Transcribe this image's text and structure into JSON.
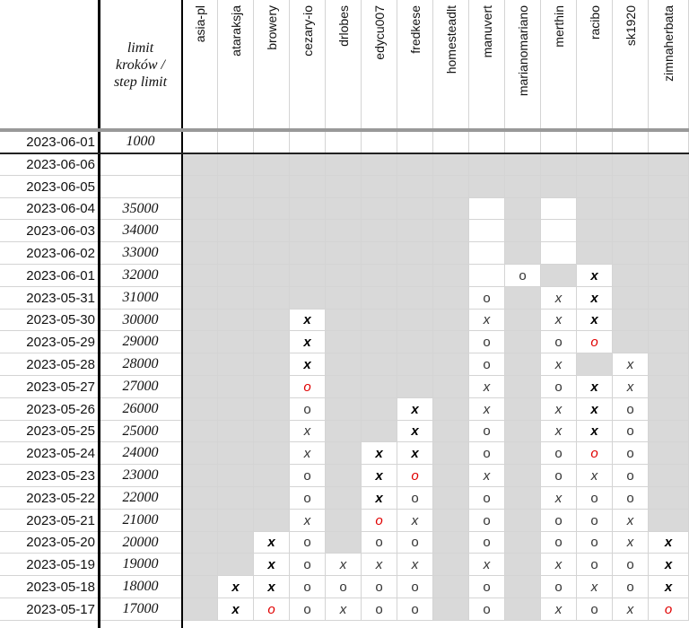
{
  "header": {
    "limit_label_line1": "limit",
    "limit_label_line2": "kroków /",
    "limit_label_line3": "step limit",
    "users": [
      "asia-pl",
      "ataraksja",
      "browery",
      "cezary-io",
      "drlobes",
      "edycu007",
      "fredkese",
      "homesteadlt",
      "manuvert",
      "marianomariano",
      "merthin",
      "racibo",
      "sk1920",
      "zimnaherbata"
    ]
  },
  "summary_row": {
    "date": "2023-06-01",
    "limit": "1000"
  },
  "rows": [
    {
      "date": "2023-06-06",
      "limit": ""
    },
    {
      "date": "2023-06-05",
      "limit": ""
    },
    {
      "date": "2023-06-04",
      "limit": "35000"
    },
    {
      "date": "2023-06-03",
      "limit": "34000"
    },
    {
      "date": "2023-06-02",
      "limit": "33000"
    },
    {
      "date": "2023-06-01",
      "limit": "32000"
    },
    {
      "date": "2023-05-31",
      "limit": "31000"
    },
    {
      "date": "2023-05-30",
      "limit": "30000"
    },
    {
      "date": "2023-05-29",
      "limit": "29000"
    },
    {
      "date": "2023-05-28",
      "limit": "28000"
    },
    {
      "date": "2023-05-27",
      "limit": "27000"
    },
    {
      "date": "2023-05-26",
      "limit": "26000"
    },
    {
      "date": "2023-05-25",
      "limit": "25000"
    },
    {
      "date": "2023-05-24",
      "limit": "24000"
    },
    {
      "date": "2023-05-23",
      "limit": "23000"
    },
    {
      "date": "2023-05-22",
      "limit": "22000"
    },
    {
      "date": "2023-05-21",
      "limit": "21000"
    },
    {
      "date": "2023-05-20",
      "limit": "20000"
    },
    {
      "date": "2023-05-19",
      "limit": "19000"
    },
    {
      "date": "2023-05-18",
      "limit": "18000"
    },
    {
      "date": "2023-05-17",
      "limit": "17000"
    }
  ],
  "grid": [
    "..............",
    "..............",
    "........ . ...",
    "........ . ...",
    "........ . ...",
    "........ o.X..",
    "........o.xX..",
    "...X....x.xX..",
    "...X....o.oO..",
    "...X....o.x.x.",
    "...O....x.oXx.",
    "...o..X.x.xXo.",
    "...x..X.o.xXo.",
    "...x.XX.o.oOo.",
    "...o.XO.x.oxo.",
    "...o.Xo.o.xoo.",
    "...x.Ox.o.oox.",
    "..Xo.oo.o.ooxX",
    "..Xoxxx.x.xooX",
    ".XXoooo.o.oxoX",
    ".XOoxoo.o.xoxO"
  ],
  "grid_note": "per-row strings, one char per user column: '.' gray empty, ' ' white empty, o/x regular marks, O red mark, X bold mark",
  "legend_glyphs": {
    "o": "o",
    "x": "x",
    "O": "o",
    "X": "x"
  },
  "colors": {
    "inactive_fill": "#d9d9d9",
    "fail_red": "#e00000",
    "gridline": "#d4d4d4"
  }
}
